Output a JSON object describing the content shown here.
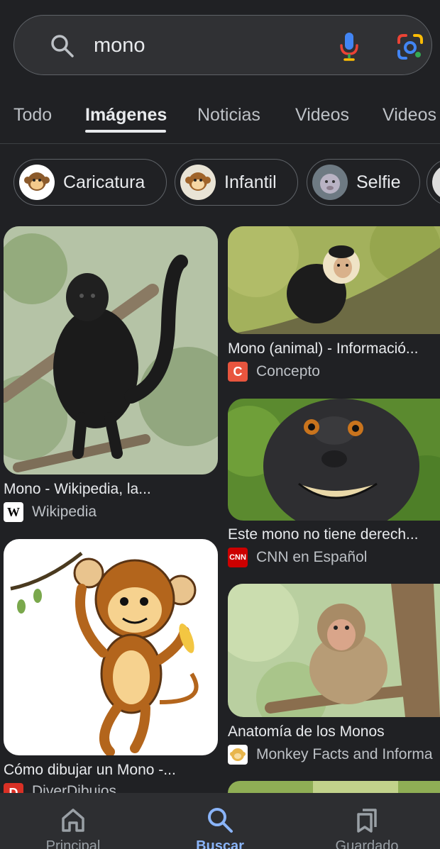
{
  "search": {
    "query": "mono"
  },
  "tabs": [
    {
      "label": "Todo"
    },
    {
      "label": "Imágenes"
    },
    {
      "label": "Noticias"
    },
    {
      "label": "Videos"
    },
    {
      "label": "Videos"
    }
  ],
  "chips": [
    {
      "label": "Caricatura"
    },
    {
      "label": "Infantil"
    },
    {
      "label": "Selfie"
    }
  ],
  "results": [
    {
      "title": "Mono - Wikipedia, la...",
      "source": "Wikipedia",
      "favicon": "W"
    },
    {
      "title": "Cómo dibujar un Mono -...",
      "source": "DiverDibujos",
      "favicon": "D"
    },
    {
      "title": "Mono (animal) - Informació...",
      "source": "Concepto",
      "favicon": "C"
    },
    {
      "title": "Este mono no tiene derech...",
      "source": "CNN en Español",
      "favicon": "CNN"
    },
    {
      "title": "Anatomía de los Monos",
      "source": "Monkey Facts and Informa",
      "favicon": "monkey-face-icon"
    }
  ],
  "nav": [
    {
      "label": "Principal",
      "icon": "home-icon"
    },
    {
      "label": "Buscar",
      "icon": "search-icon"
    },
    {
      "label": "Guardado",
      "icon": "bookmarks-icon"
    }
  ],
  "colors": {
    "background": "#202124",
    "accent": "#8ab4f8"
  }
}
